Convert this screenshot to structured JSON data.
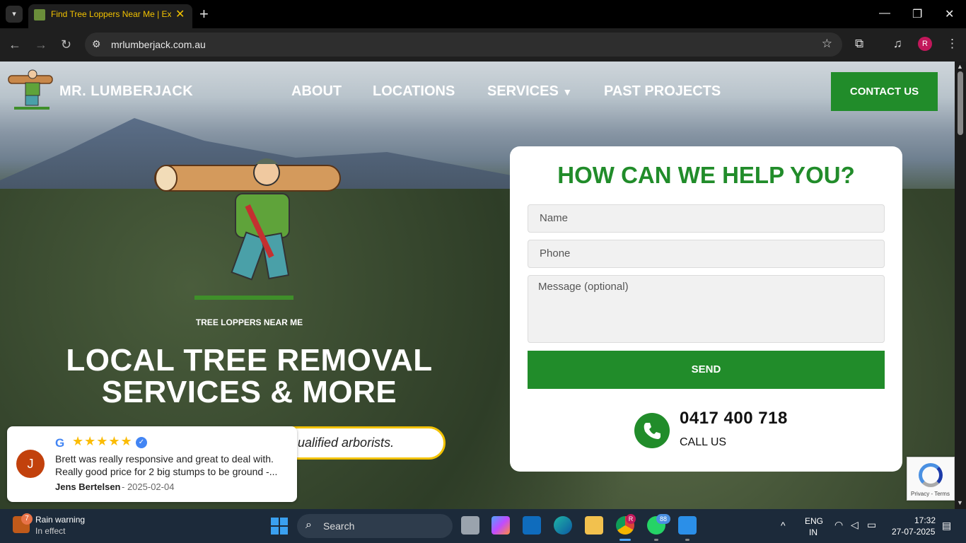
{
  "browser": {
    "tab_title": "Find Tree Loppers Near Me | Exp",
    "url": "mrlumberjack.com.au",
    "profile_initial": "R"
  },
  "site": {
    "logo_text": "MR. LUMBERJACK",
    "nav": [
      "ABOUT",
      "LOCATIONS",
      "SERVICES",
      "PAST PROJECTS"
    ],
    "contact_button": "CONTACT US"
  },
  "hero": {
    "eyebrow": "TREE LOPPERS NEAR ME",
    "headline_line1": "LOCAL TREE REMOVAL",
    "headline_line2": "SERVICES & MORE",
    "pill_text": "ualified arborists."
  },
  "form": {
    "title": "HOW CAN WE HELP YOU?",
    "name_placeholder": "Name",
    "phone_placeholder": "Phone",
    "message_placeholder": "Message (optional)",
    "send_label": "SEND",
    "phone_number": "0417 400 718",
    "call_label": "CALL US"
  },
  "review": {
    "initial": "J",
    "g": "G",
    "stars": "★★★★★",
    "text": "Brett was really responsive and great to deal with. Really good price for 2 big stumps to be ground -...",
    "author": "Jens Bertelsen",
    "date": "- 2025-02-04"
  },
  "recaptcha": {
    "links": "Privacy - Terms"
  },
  "taskbar": {
    "weather_badge": "7",
    "weather_title": "Rain warning",
    "weather_sub": "In effect",
    "search_label": "Search",
    "whatsapp_badge": "88",
    "chrome_badge": "R",
    "lang1": "ENG",
    "lang2": "IN",
    "time": "17:32",
    "date": "27-07-2025"
  },
  "colors": {
    "brand_green": "#218c2a",
    "accent_yellow": "#f2c200"
  }
}
